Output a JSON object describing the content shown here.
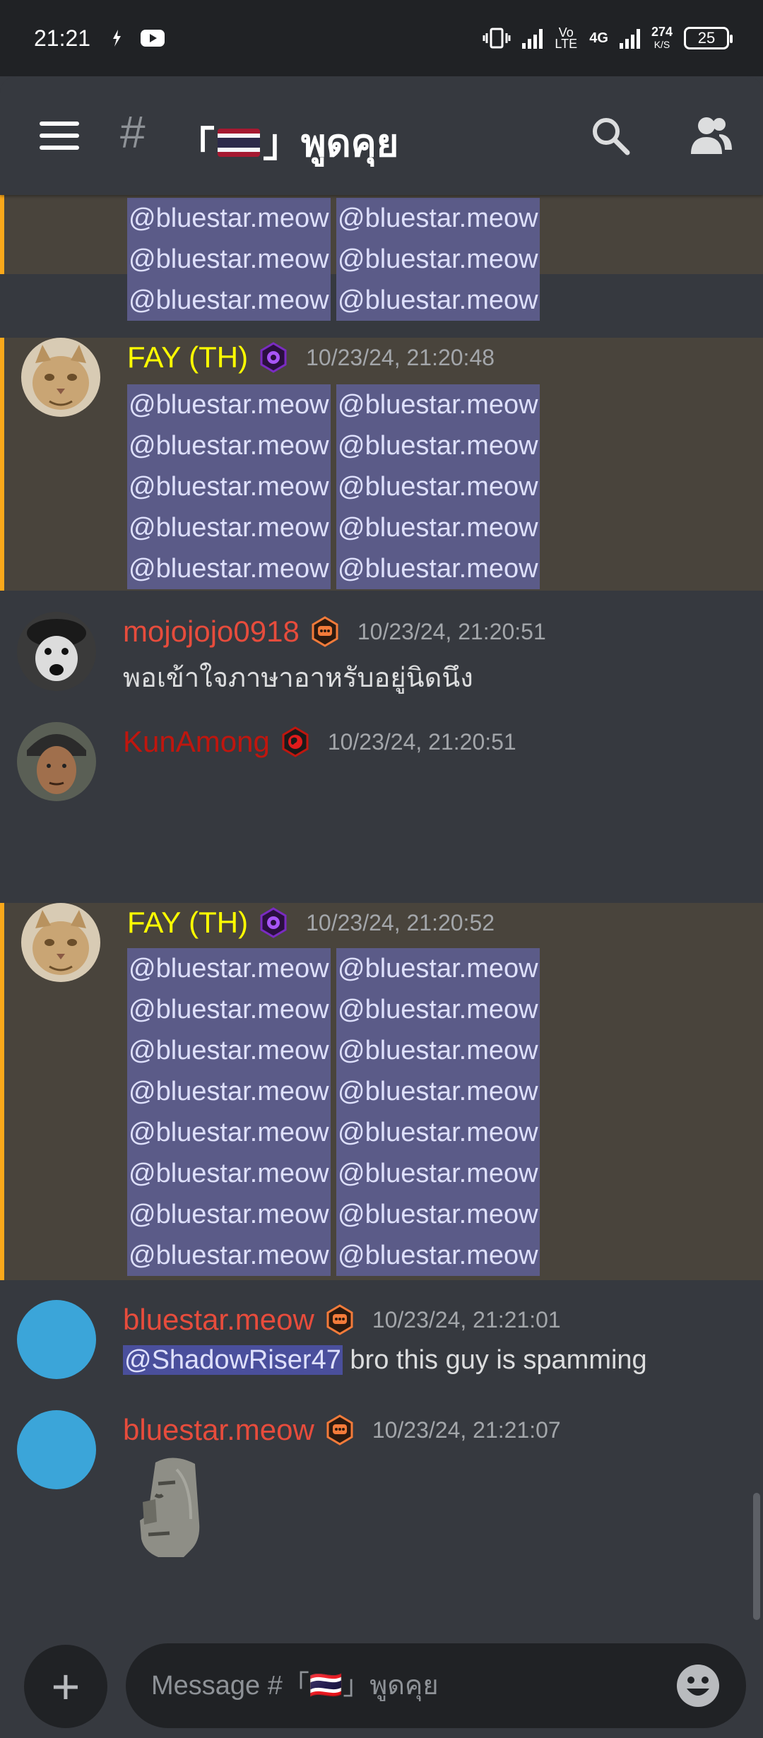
{
  "status_bar": {
    "time": "21:21",
    "network_speed_value": "274",
    "network_speed_unit": "K/S",
    "network_type": "4G",
    "volte": "Vo LTE",
    "battery": "25"
  },
  "header": {
    "hash": "#",
    "channel_name_prefix": "「",
    "channel_name_suffix": "」พูดคุย"
  },
  "messages": [
    {
      "type": "mention_block_continuation",
      "mentions": [
        "@bluestar.meow",
        "@bluestar.meow",
        "@bluestar.meow",
        "@bluestar.meow",
        "@bluestar.meow",
        "@bluestar.meow"
      ]
    },
    {
      "author": "FAY (TH)",
      "author_color": "#ffff00",
      "timestamp": "10/23/24, 21:20:48",
      "mentions": [
        "@bluestar.meow",
        "@bluestar.meow",
        "@bluestar.meow",
        "@bluestar.meow",
        "@bluestar.meow",
        "@bluestar.meow",
        "@bluestar.meow",
        "@bluestar.meow",
        "@bluestar.meow",
        "@bluestar.meow"
      ]
    },
    {
      "author": "mojojojo0918",
      "author_color": "#e74c3c",
      "timestamp": "10/23/24, 21:20:51",
      "text": "พอเข้าใจภาษาอาหรับอยู่นิดนึง"
    },
    {
      "author": "KunAmong",
      "author_color": "#c0160e",
      "timestamp": "10/23/24, 21:20:51"
    },
    {
      "author": "FAY (TH)",
      "author_color": "#ffff00",
      "timestamp": "10/23/24, 21:20:52",
      "mentions": [
        "@bluestar.meow",
        "@bluestar.meow",
        "@bluestar.meow",
        "@bluestar.meow",
        "@bluestar.meow",
        "@bluestar.meow",
        "@bluestar.meow",
        "@bluestar.meow",
        "@bluestar.meow",
        "@bluestar.meow",
        "@bluestar.meow",
        "@bluestar.meow",
        "@bluestar.meow",
        "@bluestar.meow",
        "@bluestar.meow",
        "@bluestar.meow"
      ]
    },
    {
      "author": "bluestar.meow",
      "author_color": "#e74c3c",
      "timestamp": "10/23/24, 21:21:01",
      "mention": "@ShadowRiser47",
      "text": " bro this guy is spamming"
    },
    {
      "author": "bluestar.meow",
      "author_color": "#e74c3c",
      "timestamp": "10/23/24, 21:21:07",
      "attachment_icon": "moai-emoji-icon"
    }
  ],
  "composer": {
    "placeholder": "Message #「🇹🇭」พูดคุย"
  },
  "colors": {
    "background": "#36393f",
    "highlight_bg": "#49443c",
    "highlight_border": "#faa81a",
    "mention_bg": "#5b5b88",
    "role_badge_purple": "#6b21a8",
    "role_badge_orange": "#f47b3a",
    "role_badge_red": "#c0160e",
    "avatar_blue": "#3ba5d9"
  },
  "icons": {
    "menu": "hamburger-menu-icon",
    "search": "search-icon",
    "members": "members-icon",
    "add": "plus-icon",
    "emoji": "emoji-icon",
    "role_purple": "gear-role-badge-icon",
    "role_orange": "chat-role-badge-icon",
    "role_red": "globe-role-badge-icon"
  }
}
